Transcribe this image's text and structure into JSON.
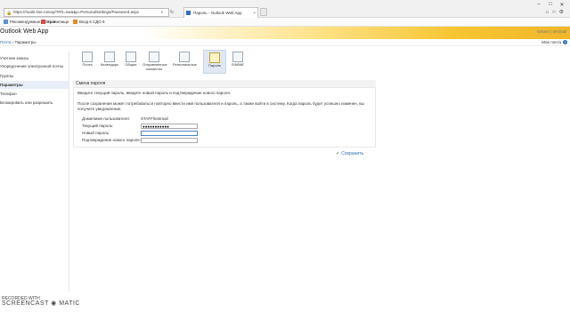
{
  "browser": {
    "url": "https://mail2.hse.ru/ecp/?Rfr=owa&p=PersonalSettings/Password.aspx",
    "tab_title": "Пароль - Outlook Web App",
    "favorites": [
      "Рекомендуемые сайты ▾",
      "Хранилище",
      "Вход в СДО 6"
    ]
  },
  "owa": {
    "logo": "Outlook Web App",
    "user": "system | testmail",
    "breadcrumb_home": "Почта",
    "breadcrumb_sep": "›",
    "breadcrumb_current": "Параметры",
    "new_message": "Мое почта",
    "help": "?"
  },
  "leftnav": [
    {
      "label": "Учетная запись",
      "active": false
    },
    {
      "label": "Упорядочение электронной почты",
      "active": false
    },
    {
      "label": "Группы",
      "active": false
    },
    {
      "label": "Параметры",
      "active": true
    },
    {
      "label": "Телефон",
      "active": false
    },
    {
      "label": "Блокировать или разрешить",
      "active": false
    }
  ],
  "toolbar": [
    {
      "label": "Почта",
      "icon": "mail-icon"
    },
    {
      "label": "Календарь",
      "icon": "calendar-icon"
    },
    {
      "label": "Общие",
      "icon": "general-icon"
    },
    {
      "label": "Отправленные элементы",
      "icon": "sent-items-icon"
    },
    {
      "label": "Региональные",
      "icon": "regional-icon"
    },
    {
      "label": "Пароль",
      "icon": "key-icon"
    },
    {
      "label": "S/MIME",
      "icon": "smime-icon"
    }
  ],
  "section": {
    "title": "Смена пароля",
    "intro": "Введите текущий пароль, введите новый пароль и подтверждение нового пароля.",
    "note": "После сохранения может потребоваться повторно ввести имя пользователя и пароль, а также войти в систему. Когда пароль будет успешно изменен, вы получите уведомление."
  },
  "form": {
    "domain_label": "Домен\\имя пользователя:",
    "domain_value": "STAFF\\testmail",
    "current_label": "Текущий пароль:",
    "current_value": "●●●●●●●●●●●",
    "new_label": "Новый пароль:",
    "new_value": "",
    "confirm_label": "Подтверждение нового пароля:",
    "confirm_value": "",
    "save_label": "Сохранить"
  },
  "watermark": {
    "line1": "RECORDED WITH",
    "line2": "SCREENCAST ◉ MATIC"
  }
}
